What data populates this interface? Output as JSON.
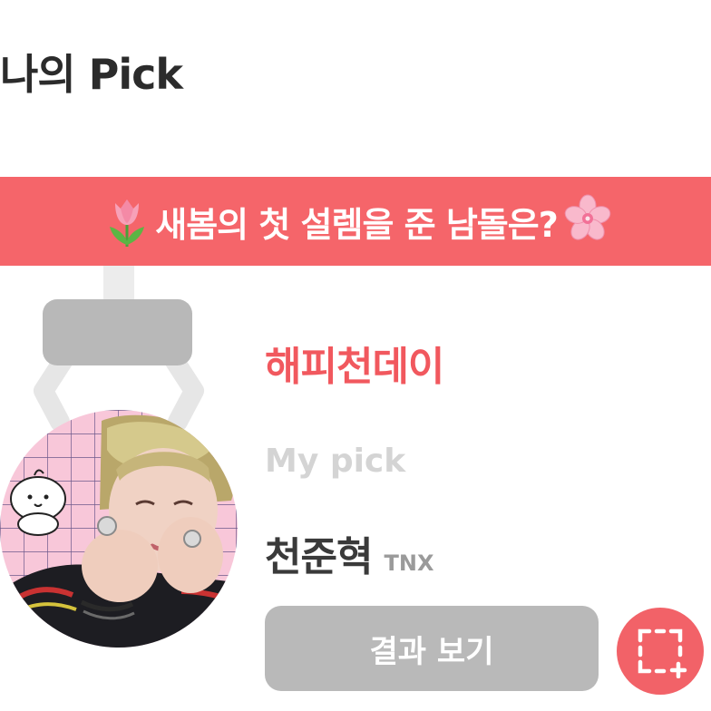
{
  "page": {
    "title": "나의 Pick"
  },
  "banner": {
    "text": "새봄의 첫 설렘을 준 남돌은?",
    "left_icon": "tulip-icon",
    "right_icon": "cherry-blossom-icon"
  },
  "vote": {
    "title": "해피천데이",
    "my_pick_label": "My pick",
    "pick_name": "천준혁",
    "pick_group": "TNX"
  },
  "actions": {
    "result_button": "결과 보기",
    "capture_icon": "screenshot-crop-icon"
  },
  "colors": {
    "accent": "#f5656a",
    "button_gray": "#b9b9b9"
  }
}
